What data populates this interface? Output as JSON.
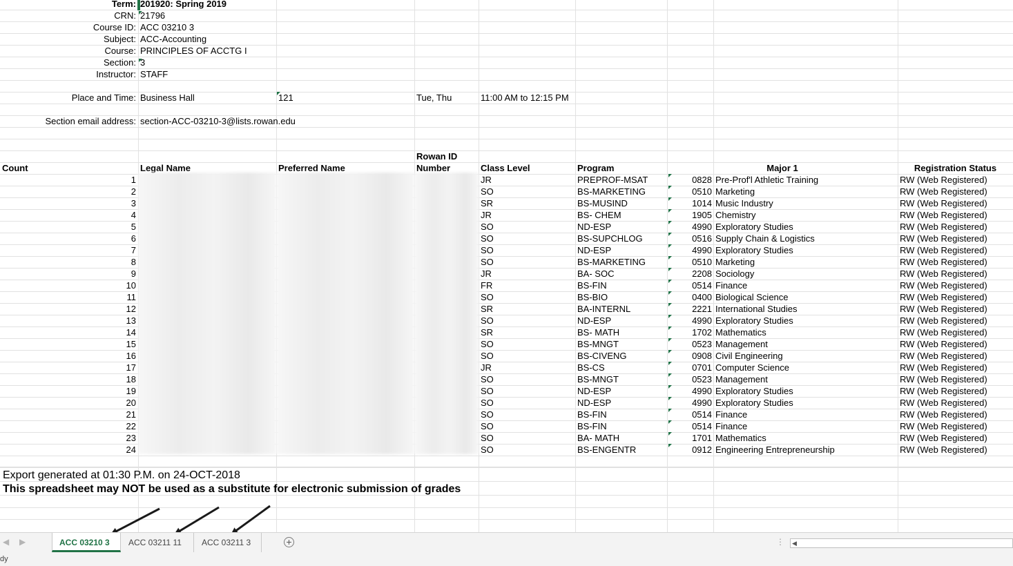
{
  "header": {
    "rows": [
      {
        "label": "Term:",
        "value": "201920: Spring 2019",
        "bold": true
      },
      {
        "label": "CRN:",
        "value": "21796"
      },
      {
        "label": "Course ID:",
        "value": "ACC 03210 3"
      },
      {
        "label": "Subject:",
        "value": "ACC-Accounting"
      },
      {
        "label": "Course:",
        "value": "PRINCIPLES OF ACCTG I"
      },
      {
        "label": "Section:",
        "value": "3"
      },
      {
        "label": "Instructor:",
        "value": "STAFF"
      }
    ],
    "place_label": "Place and Time:",
    "building": "Business Hall",
    "room": "121",
    "days": "Tue, Thu",
    "time": "11:00 AM to 12:15 PM",
    "email_label": "Section email address:",
    "email": "section-ACC-03210-3@lists.rowan.edu"
  },
  "table": {
    "columns": {
      "count": "Count",
      "legal_name": "Legal Name",
      "preferred_name": "Preferred Name",
      "rowan_id_1": "Rowan ID",
      "rowan_id_2": "Number",
      "class_level": "Class Level",
      "program": "Program",
      "major": "Major 1",
      "status": "Registration Status"
    },
    "rows": [
      {
        "count": "1",
        "level": "JR",
        "program": "PREPROF-MSAT",
        "code": "0828",
        "major": "Pre-Prof'l Athletic Training",
        "status": "RW (Web Registered)"
      },
      {
        "count": "2",
        "level": "SO",
        "program": "BS-MARKETING",
        "code": "0510",
        "major": "Marketing",
        "status": "RW (Web Registered)"
      },
      {
        "count": "3",
        "level": "SR",
        "program": "BS-MUSIND",
        "code": "1014",
        "major": "Music Industry",
        "status": "RW (Web Registered)"
      },
      {
        "count": "4",
        "level": "JR",
        "program": "BS- CHEM",
        "code": "1905",
        "major": "Chemistry",
        "status": "RW (Web Registered)"
      },
      {
        "count": "5",
        "level": "SO",
        "program": "ND-ESP",
        "code": "4990",
        "major": "Exploratory Studies",
        "status": "RW (Web Registered)"
      },
      {
        "count": "6",
        "level": "SO",
        "program": "BS-SUPCHLOG",
        "code": "0516",
        "major": "Supply Chain & Logistics",
        "status": "RW (Web Registered)"
      },
      {
        "count": "7",
        "level": "SO",
        "program": "ND-ESP",
        "code": "4990",
        "major": "Exploratory Studies",
        "status": "RW (Web Registered)"
      },
      {
        "count": "8",
        "level": "SO",
        "program": "BS-MARKETING",
        "code": "0510",
        "major": "Marketing",
        "status": "RW (Web Registered)"
      },
      {
        "count": "9",
        "level": "JR",
        "program": "BA- SOC",
        "code": "2208",
        "major": "Sociology",
        "status": "RW (Web Registered)"
      },
      {
        "count": "10",
        "level": "FR",
        "program": "BS-FIN",
        "code": "0514",
        "major": "Finance",
        "status": "RW (Web Registered)"
      },
      {
        "count": "11",
        "level": "SO",
        "program": "BS-BIO",
        "code": "0400",
        "major": "Biological Science",
        "status": "RW (Web Registered)"
      },
      {
        "count": "12",
        "level": "SR",
        "program": "BA-INTERNL",
        "code": "2221",
        "major": "International Studies",
        "status": "RW (Web Registered)"
      },
      {
        "count": "13",
        "level": "SO",
        "program": "ND-ESP",
        "code": "4990",
        "major": "Exploratory Studies",
        "status": "RW (Web Registered)"
      },
      {
        "count": "14",
        "level": "SR",
        "program": "BS- MATH",
        "code": "1702",
        "major": "Mathematics",
        "status": "RW (Web Registered)"
      },
      {
        "count": "15",
        "level": "SO",
        "program": "BS-MNGT",
        "code": "0523",
        "major": "Management",
        "status": "RW (Web Registered)"
      },
      {
        "count": "16",
        "level": "SO",
        "program": "BS-CIVENG",
        "code": "0908",
        "major": "Civil Engineering",
        "status": "RW (Web Registered)"
      },
      {
        "count": "17",
        "level": "JR",
        "program": "BS-CS",
        "code": "0701",
        "major": "Computer Science",
        "status": "RW (Web Registered)"
      },
      {
        "count": "18",
        "level": "SO",
        "program": "BS-MNGT",
        "code": "0523",
        "major": "Management",
        "status": "RW (Web Registered)"
      },
      {
        "count": "19",
        "level": "SO",
        "program": "ND-ESP",
        "code": "4990",
        "major": "Exploratory Studies",
        "status": "RW (Web Registered)"
      },
      {
        "count": "20",
        "level": "SO",
        "program": "ND-ESP",
        "code": "4990",
        "major": "Exploratory Studies",
        "status": "RW (Web Registered)"
      },
      {
        "count": "21",
        "level": "SO",
        "program": "BS-FIN",
        "code": "0514",
        "major": "Finance",
        "status": "RW (Web Registered)"
      },
      {
        "count": "22",
        "level": "SO",
        "program": "BS-FIN",
        "code": "0514",
        "major": "Finance",
        "status": "RW (Web Registered)"
      },
      {
        "count": "23",
        "level": "SO",
        "program": "BA- MATH",
        "code": "1701",
        "major": "Mathematics",
        "status": "RW (Web Registered)"
      },
      {
        "count": "24",
        "level": "SO",
        "program": "BS-ENGENTR",
        "code": "0912",
        "major": "Engineering Entrepreneurship",
        "status": "RW (Web Registered)"
      }
    ]
  },
  "footer": {
    "export_note": "Export generated at 01:30 P.M. on 24-OCT-2018",
    "warning": "This spreadsheet may NOT be used as a substitute for electronic submission of grades"
  },
  "tabs": [
    {
      "label": "ACC 03210 3",
      "active": true
    },
    {
      "label": "ACC 03211 11",
      "active": false
    },
    {
      "label": "ACC 03211 3",
      "active": false
    }
  ],
  "status_bar": {
    "text": "dy"
  },
  "colors": {
    "accent": "#217346",
    "grid": "#e1e1e1",
    "tabbar": "#f3f3f3"
  }
}
